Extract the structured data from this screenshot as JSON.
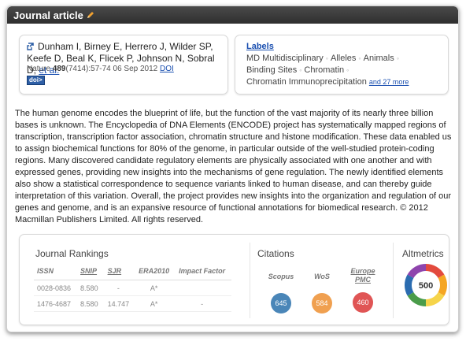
{
  "header": {
    "title": "Journal article"
  },
  "citation": {
    "authors": "Dunham I, Birney E, Herrero J, Wilder SP, Keefe D, Beal K, Flicek P, Johnson N, Sobral D,",
    "etal": "et al.",
    "journal": "Nature",
    "volume": "489",
    "issue_pages": "(7414):57-74 06 Sep 2012",
    "doi_link": "DOI",
    "doi_badge": "doi>"
  },
  "labels": {
    "title": "Labels",
    "items": [
      "MD Multidisciplinary",
      "Alleles",
      "Animals",
      "Binding Sites",
      "Chromatin",
      "Chromatin Immunoprecipitation"
    ],
    "more": "and 27 more"
  },
  "abstract": "The human genome encodes the blueprint of life, but the function of the vast majority of its nearly three billion bases is unknown. The Encyclopedia of DNA Elements (ENCODE) project has systematically mapped regions of transcription, transcription factor association, chromatin structure and histone modification. These data enabled us to assign biochemical functions for 80% of the genome, in particular outside of the well-studied protein-coding regions. Many discovered candidate regulatory elements are physically associated with one another and with expressed genes, providing new insights into the mechanisms of gene regulation. The newly identified elements also show a statistical correspondence to sequence variants linked to human disease, and can thereby guide interpretation of this variation. Overall, the project provides new insights into the organization and regulation of our genes and genome, and is an expansive resource of functional annotations for biomedical research. © 2012 Macmillan Publishers Limited. All rights reserved.",
  "rankings": {
    "title": "Journal Rankings",
    "columns": [
      "ISSN",
      "SNIP",
      "SJR",
      "ERA2010",
      "Impact Factor"
    ],
    "rows": [
      [
        "0028-0836",
        "8.580",
        "-",
        "A*",
        ""
      ],
      [
        "1476-4687",
        "8.580",
        "14.747",
        "A*",
        "-"
      ]
    ]
  },
  "citations": {
    "title": "Citations",
    "sources": [
      {
        "label": "Scopus",
        "count": "645",
        "color": "#4a86b8"
      },
      {
        "label": "WoS",
        "count": "584",
        "color": "#f0a050"
      },
      {
        "label": "Europe PMC",
        "count": "460",
        "color": "#e05555"
      }
    ]
  },
  "altmetrics": {
    "title": "Altmetrics",
    "score": "500"
  },
  "colors": {
    "header_bg": "#3a3a3a",
    "link": "#1a4fb0",
    "doi_badge": "#2e5fa6"
  }
}
